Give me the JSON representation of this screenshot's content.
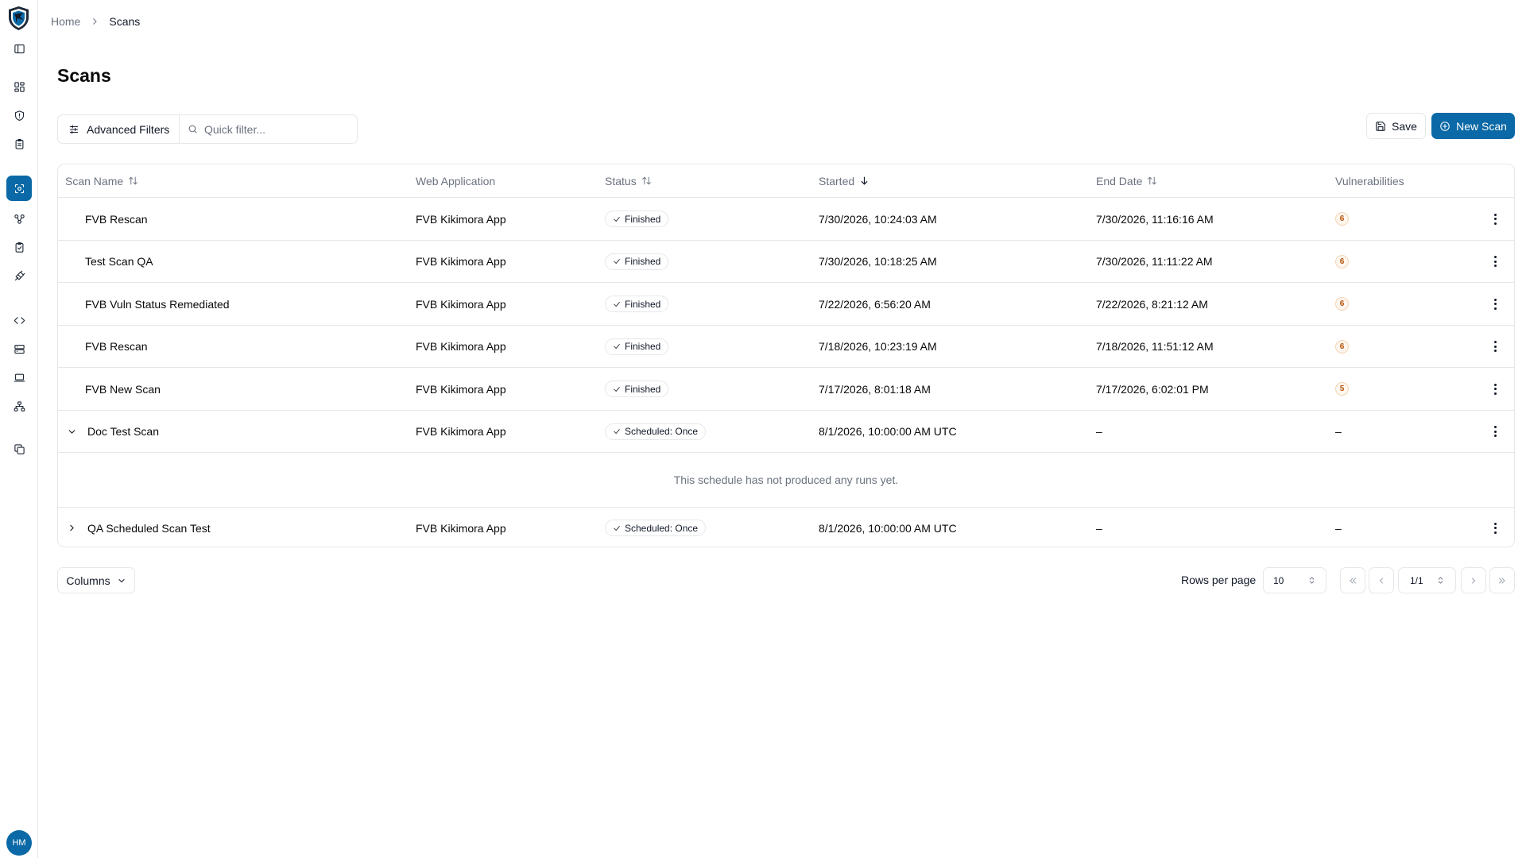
{
  "breadcrumb": {
    "home": "Home",
    "current": "Scans"
  },
  "page": {
    "title": "Scans"
  },
  "toolbar": {
    "advanced_filters": "Advanced Filters",
    "quick_filter_placeholder": "Quick filter...",
    "save": "Save",
    "new_scan": "New Scan"
  },
  "table": {
    "headers": {
      "scan_name": "Scan Name",
      "web_application": "Web Application",
      "status": "Status",
      "started": "Started",
      "end_date": "End Date",
      "vulnerabilities": "Vulnerabilities"
    },
    "rows": [
      {
        "name": "FVB Rescan",
        "app": "FVB Kikimora App",
        "status": "Finished",
        "started": "7/30/2026, 10:24:03 AM",
        "end": "7/30/2026, 11:16:16 AM",
        "vulns": "6"
      },
      {
        "name": "Test Scan QA",
        "app": "FVB Kikimora App",
        "status": "Finished",
        "started": "7/30/2026, 10:18:25 AM",
        "end": "7/30/2026, 11:11:22 AM",
        "vulns": "6"
      },
      {
        "name": "FVB Vuln Status Remediated",
        "app": "FVB Kikimora App",
        "status": "Finished",
        "started": "7/22/2026, 6:56:20 AM",
        "end": "7/22/2026, 8:21:12 AM",
        "vulns": "6"
      },
      {
        "name": "FVB Rescan",
        "app": "FVB Kikimora App",
        "status": "Finished",
        "started": "7/18/2026, 10:23:19 AM",
        "end": "7/18/2026, 11:51:12 AM",
        "vulns": "6"
      },
      {
        "name": "FVB New Scan",
        "app": "FVB Kikimora App",
        "status": "Finished",
        "started": "7/17/2026, 8:01:18 AM",
        "end": "7/17/2026, 6:02:01 PM",
        "vulns": "5"
      },
      {
        "name": "Doc Test Scan",
        "app": "FVB Kikimora App",
        "status": "Scheduled: Once",
        "started": "8/1/2026, 10:00:00 AM UTC",
        "end": "–",
        "vulns": "–"
      },
      {
        "name": "QA Scheduled Scan Test",
        "app": "FVB Kikimora App",
        "status": "Scheduled: Once",
        "started": "8/1/2026, 10:00:00 AM UTC",
        "end": "–",
        "vulns": "–"
      }
    ],
    "empty_schedule_message": "This schedule has not produced any runs yet."
  },
  "footer": {
    "columns": "Columns",
    "rows_per_page_label": "Rows per page",
    "rows_per_page_value": "10",
    "page_indicator": "1/1"
  },
  "user": {
    "initials": "HM"
  },
  "colors": {
    "accent": "#0a69a6",
    "border": "#e5e7eb",
    "muted": "#6b7280"
  },
  "sidebar_icons": [
    "sidebar-toggle-icon",
    "dashboard-icon",
    "shield-icon",
    "clipboard-icon",
    "scan-icon",
    "network-icon",
    "clipboard-check-icon",
    "plug-icon",
    "code-icon",
    "server-icon",
    "laptop-icon",
    "sitemap-icon",
    "copy-icon"
  ]
}
